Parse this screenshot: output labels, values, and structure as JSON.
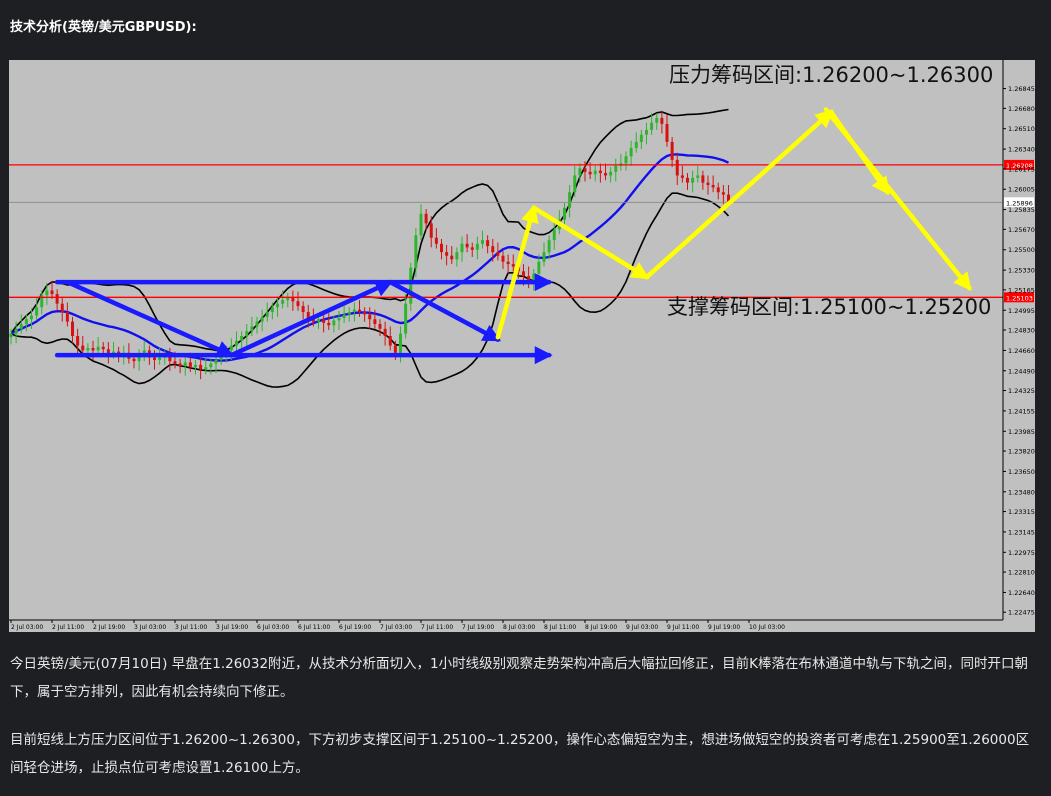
{
  "heading": "技术分析(英镑/美元GBPUSD):",
  "chart_data": {
    "type": "candlestick",
    "instrument": "GBPUSD",
    "ylim": [
      1.2241,
      1.27
    ],
    "y_ticks": [
      "1.26845",
      "1.26680",
      "1.26510",
      "1.26340",
      "1.26175",
      "1.26005",
      "1.25835",
      "1.25670",
      "1.25500",
      "1.25330",
      "1.25165",
      "1.24995",
      "1.24830",
      "1.24660",
      "1.24490",
      "1.24325",
      "1.24155",
      "1.23985",
      "1.23820",
      "1.23650",
      "1.23480",
      "1.23315",
      "1.23145",
      "1.22975",
      "1.22810",
      "1.22640",
      "1.22475"
    ],
    "x_ticks": [
      "2 Jul 03:00",
      "2 Jul 11:00",
      "2 Jul 19:00",
      "3 Jul 03:00",
      "3 Jul 11:00",
      "3 Jul 19:00",
      "6 Jul 03:00",
      "6 Jul 11:00",
      "6 Jul 19:00",
      "7 Jul 03:00",
      "7 Jul 11:00",
      "7 Jul 19:00",
      "8 Jul 03:00",
      "8 Jul 11:00",
      "8 Jul 19:00",
      "9 Jul 03:00",
      "9 Jul 11:00",
      "9 Jul 19:00",
      "10 Jul 03:00"
    ],
    "bars_per_tick": 8,
    "candles_close": [
      1.248,
      1.2484,
      1.2488,
      1.2492,
      1.2495,
      1.2502,
      1.2512,
      1.2516,
      1.2513,
      1.2505,
      1.2498,
      1.249,
      1.2478,
      1.247,
      1.2466,
      1.2468,
      1.2466,
      1.2469,
      1.2467,
      1.2463,
      1.2465,
      1.2462,
      1.2464,
      1.2459,
      1.2457,
      1.2461,
      1.2466,
      1.246,
      1.2458,
      1.246,
      1.2462,
      1.2457,
      1.2455,
      1.2453,
      1.2456,
      1.2452,
      1.2454,
      1.245,
      1.2452,
      1.2455,
      1.2458,
      1.2462,
      1.2466,
      1.247,
      1.2474,
      1.2478,
      1.2482,
      1.2486,
      1.249,
      1.2494,
      1.2498,
      1.2502,
      1.2505,
      1.2508,
      1.251,
      1.2507,
      1.2503,
      1.2498,
      1.2493,
      1.249,
      1.2492,
      1.2489,
      1.2487,
      1.2491,
      1.2493,
      1.2496,
      1.2498,
      1.25,
      1.2498,
      1.2496,
      1.2492,
      1.2488,
      1.2484,
      1.2478,
      1.247,
      1.2464,
      1.248,
      1.2505,
      1.2535,
      1.2562,
      1.258,
      1.2572,
      1.256,
      1.2555,
      1.2548,
      1.2545,
      1.2542,
      1.2548,
      1.2555,
      1.2552,
      1.255,
      1.2555,
      1.2558,
      1.2553,
      1.2548,
      1.2545,
      1.254,
      1.2538,
      1.2536,
      1.2532,
      1.2528,
      1.2522,
      1.253,
      1.254,
      1.2548,
      1.2558,
      1.2567,
      1.2575,
      1.2585,
      1.2598,
      1.2612,
      1.2618,
      1.2615,
      1.2613,
      1.2616,
      1.2614,
      1.2612,
      1.2615,
      1.262,
      1.2622,
      1.2628,
      1.2635,
      1.264,
      1.2646,
      1.265,
      1.2656,
      1.266,
      1.2655,
      1.264,
      1.2625,
      1.2612,
      1.261,
      1.2606,
      1.261,
      1.2612,
      1.2606,
      1.2604,
      1.2602,
      1.2598,
      1.2596,
      1.259
    ],
    "current_price": "1.25896",
    "ma_period": 20,
    "bb_period": 20,
    "bb_std": 2,
    "levels": [
      {
        "value": 1.26208,
        "label": "1.26208"
      },
      {
        "value": 1.25103,
        "label": "1.25103"
      }
    ],
    "annotations": {
      "resistance": "压力筹码区间:1.26200~1.26300",
      "support": "支撑筹码区间:1.25100~1.25200"
    },
    "colors": {
      "background": "#c0c0c0",
      "bull": "#2db52d",
      "bear": "#d81010",
      "middle_band": "#1010ee",
      "bands": "#000000",
      "levels": "#ff0000",
      "blue_arrows": "#1a1aff",
      "yellow_arrows": "#ffff00"
    },
    "blue_arrows": [
      [
        {
          "t": 9,
          "p": 1.2523
        },
        {
          "t": 105,
          "p": 1.2523
        }
      ],
      [
        {
          "t": 9,
          "p": 1.2462
        },
        {
          "t": 105,
          "p": 1.2462
        }
      ],
      [
        {
          "t": 11,
          "p": 1.2523
        },
        {
          "t": 43,
          "p": 1.2462
        }
      ],
      [
        {
          "t": 43,
          "p": 1.2462
        },
        {
          "t": 74,
          "p": 1.2523
        }
      ],
      [
        {
          "t": 74,
          "p": 1.2523
        },
        {
          "t": 95,
          "p": 1.2475
        }
      ]
    ],
    "yellow_arrows": [
      [
        {
          "t": 95,
          "p": 1.2477
        },
        {
          "t": 102,
          "p": 1.2585
        }
      ],
      [
        {
          "t": 102,
          "p": 1.2585
        },
        {
          "t": 124,
          "p": 1.2527
        }
      ],
      [
        {
          "t": 124,
          "p": 1.2527
        },
        {
          "t": 160,
          "p": 1.2665
        }
      ],
      [
        {
          "t": 160,
          "p": 1.2665
        },
        {
          "t": 171,
          "p": 1.2598
        }
      ],
      [
        {
          "t": 159,
          "p": 1.2667
        },
        {
          "t": 187,
          "p": 1.2518
        }
      ]
    ]
  },
  "paragraph1": "今日英镑/美元(07月10日) 早盘在1.26032附近，从技术分析面切入，1小时线级别观察走势架构冲高后大幅拉回修正，目前K棒落在布林通道中轨与下轨之间，同时开口朝下，属于空方排列，因此有机会持续向下修正。",
  "paragraph2": "目前短线上方压力区间位于1.26200~1.26300，下方初步支撑区间于1.25100~1.25200，操作心态偏短空为主，想进场做短空的投资者可考虑在1.25900至1.26000区间轻仓进场，止损点位可考虑设置1.26100上方。"
}
